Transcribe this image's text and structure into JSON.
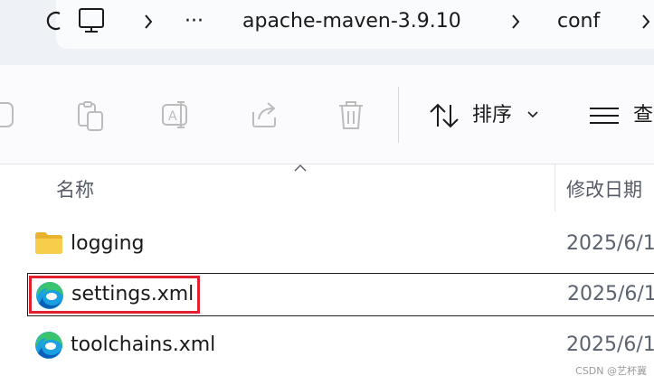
{
  "breadcrumb": {
    "more": "···",
    "folder": "apache-maven-3.9.10",
    "current": "conf"
  },
  "toolbar": {
    "sort_label": "排序",
    "view_label": "查看"
  },
  "columns": {
    "name": "名称",
    "date": "修改日期"
  },
  "files": [
    {
      "name": "logging",
      "date": "2025/6/1",
      "type": "folder",
      "icon": "folder-icon"
    },
    {
      "name": "settings.xml",
      "date": "2025/6/1",
      "type": "xml",
      "icon": "edge-icon",
      "selected": true,
      "highlighted": true
    },
    {
      "name": "toolchains.xml",
      "date": "2025/6/1",
      "type": "xml",
      "icon": "edge-icon"
    }
  ],
  "watermark": "CSDN @艺杯冀",
  "colors": {
    "highlight": "#e0202e",
    "folder": "#f5c242"
  }
}
